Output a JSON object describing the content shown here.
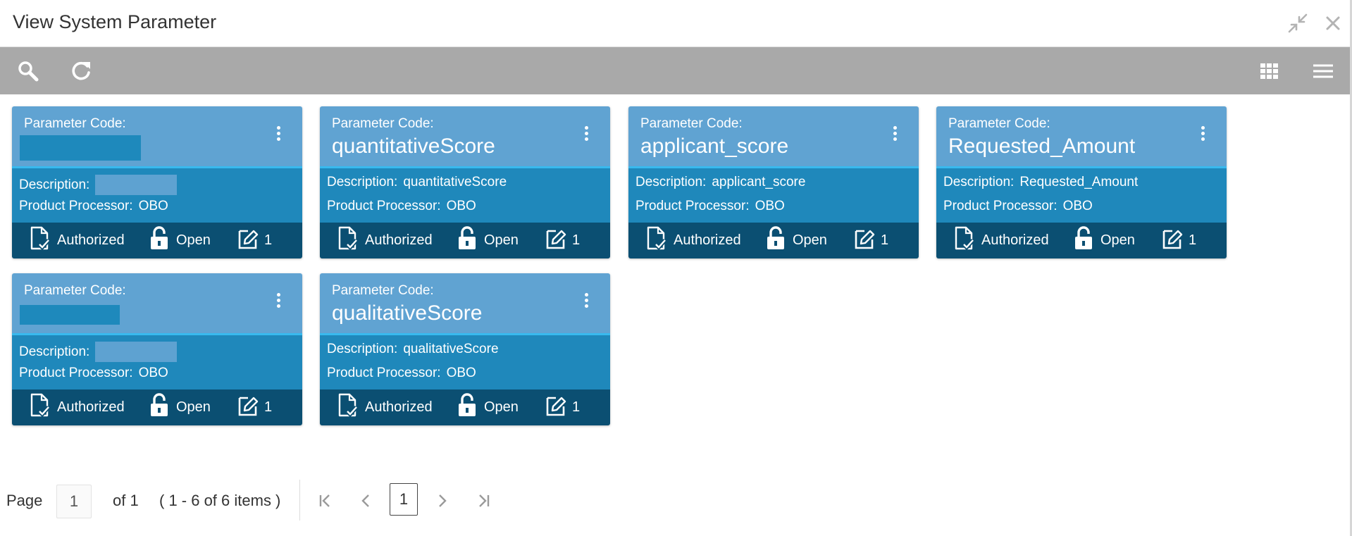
{
  "window": {
    "title": "View System Parameter"
  },
  "cards": [
    {
      "label": "Parameter Code:",
      "code": "",
      "description_label": "Description:",
      "description": "",
      "processor_label": "Product Processor:",
      "processor": "OBO",
      "status": "Authorized",
      "lock": "Open",
      "edits": "1"
    },
    {
      "label": "Parameter Code:",
      "code": "quantitativeScore",
      "description_label": "Description:",
      "description": "quantitativeScore",
      "processor_label": "Product Processor:",
      "processor": "OBO",
      "status": "Authorized",
      "lock": "Open",
      "edits": "1"
    },
    {
      "label": "Parameter Code:",
      "code": "applicant_score",
      "description_label": "Description:",
      "description": "applicant_score",
      "processor_label": "Product Processor:",
      "processor": "OBO",
      "status": "Authorized",
      "lock": "Open",
      "edits": "1"
    },
    {
      "label": "Parameter Code:",
      "code": "Requested_Amount",
      "description_label": "Description:",
      "description": "Requested_Amount",
      "processor_label": "Product Processor:",
      "processor": "OBO",
      "status": "Authorized",
      "lock": "Open",
      "edits": "1"
    },
    {
      "label": "Parameter Code:",
      "code": "",
      "description_label": "Description:",
      "description": "",
      "processor_label": "Product Processor:",
      "processor": "OBO",
      "status": "Authorized",
      "lock": "Open",
      "edits": "1"
    },
    {
      "label": "Parameter Code:",
      "code": "qualitativeScore",
      "description_label": "Description:",
      "description": "qualitativeScore",
      "processor_label": "Product Processor:",
      "processor": "OBO",
      "status": "Authorized",
      "lock": "Open",
      "edits": "1"
    }
  ],
  "pagination": {
    "page_label": "Page",
    "page_value": "1",
    "of_label": "of 1",
    "range_label": "( 1 - 6 of 6 items )",
    "current": "1"
  },
  "colors": {
    "card_header": "#60a3d2",
    "card_body": "#1f88bb",
    "card_footer": "#0b4f72",
    "header_border": "#38b9ee",
    "toolbar": "#a9a9a9"
  },
  "icons": {
    "search": "search-icon",
    "refresh": "refresh-icon",
    "grid": "grid-view-icon",
    "list": "list-view-icon",
    "minimize": "minimize-icon",
    "close": "close-icon"
  }
}
